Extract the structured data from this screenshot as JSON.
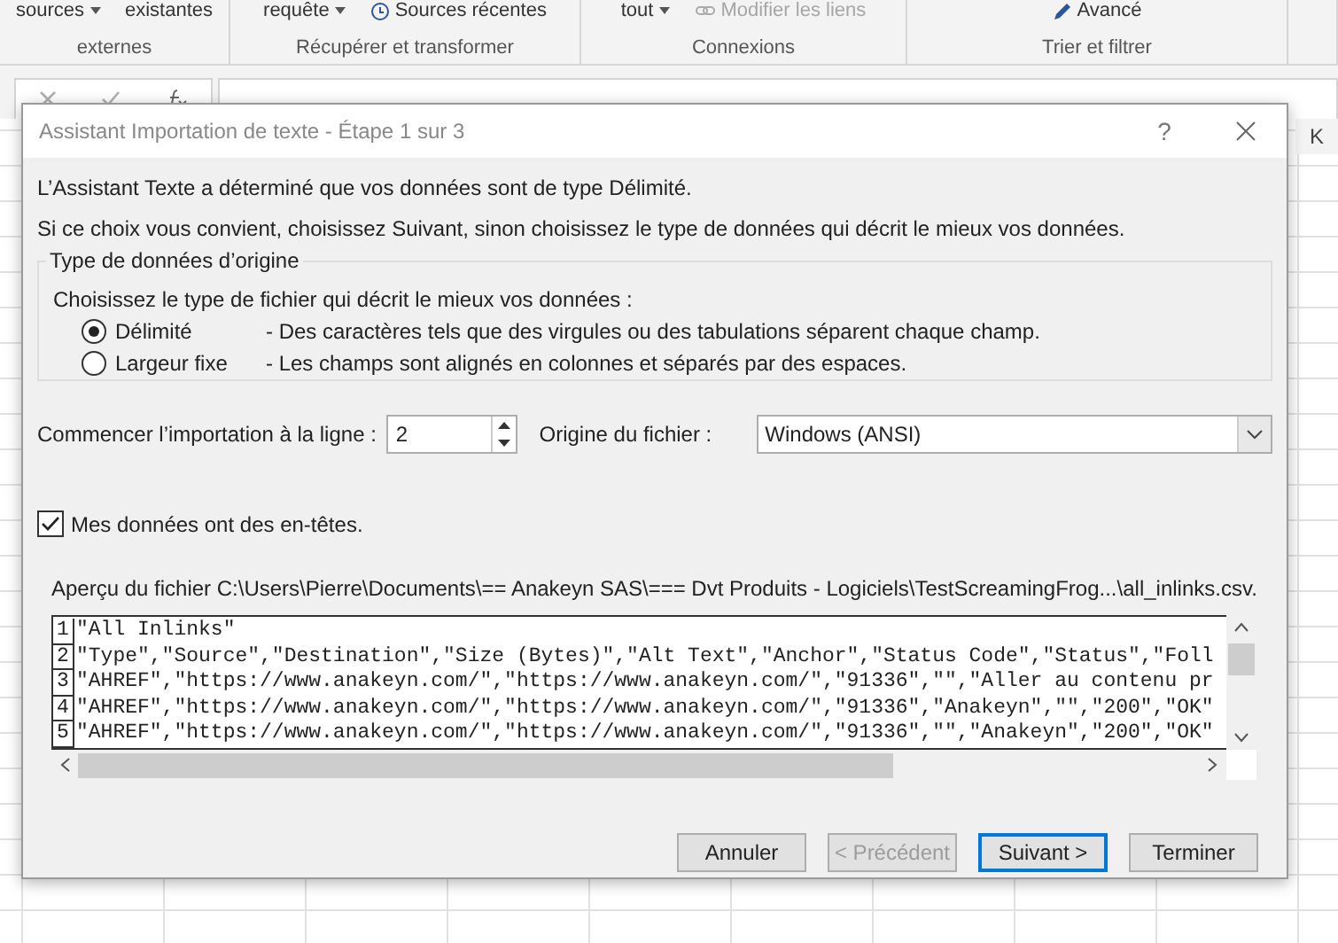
{
  "ribbon": {
    "groups": [
      {
        "label": "externes",
        "items": [
          {
            "label": "sources",
            "dropdown": true,
            "disabled": false
          },
          {
            "label": "existantes",
            "dropdown": false,
            "disabled": false
          }
        ]
      },
      {
        "label": "Récupérer et transformer",
        "items": [
          {
            "label": "requête",
            "dropdown": true,
            "disabled": false
          },
          {
            "label": "Sources récentes",
            "dropdown": false,
            "disabled": false
          }
        ]
      },
      {
        "label": "Connexions",
        "items": [
          {
            "label": "tout",
            "dropdown": true,
            "disabled": false
          },
          {
            "label": "Modifier les liens",
            "dropdown": false,
            "disabled": true
          }
        ]
      },
      {
        "label": "Trier et filtrer",
        "items": [
          {
            "label": "Avancé",
            "dropdown": false,
            "disabled": false
          }
        ]
      }
    ]
  },
  "sheet": {
    "visible_column": "K"
  },
  "dialog": {
    "title": "Assistant Importation de texte - Étape 1 sur 3",
    "help": "?",
    "intro": [
      "L’Assistant Texte a déterminé que vos données sont de type Délimité.",
      "Si ce choix vous convient, choisissez Suivant, sinon choisissez le type de données qui décrit le mieux vos données."
    ],
    "group": {
      "title": "Type de données d’origine",
      "prompt": "Choisissez le type de fichier qui décrit le mieux vos données :",
      "options": [
        {
          "label": "Délimité",
          "description": "- Des caractères tels que des virgules ou des tabulations séparent chaque champ.",
          "selected": true
        },
        {
          "label": "Largeur fixe",
          "description": "- Les champs sont alignés en colonnes et séparés par des espaces.",
          "selected": false
        }
      ]
    },
    "start_row": {
      "label": "Commencer l’importation à la ligne :",
      "value": "2"
    },
    "origin": {
      "label": "Origine du fichier :",
      "value": "Windows (ANSI)"
    },
    "headers": {
      "label": "Mes données ont des en-têtes.",
      "checked": true
    },
    "preview": {
      "label": "Aperçu du fichier C:\\Users\\Pierre\\Documents\\== Anakeyn SAS\\=== Dvt Produits - Logiciels\\TestScreamingFrog...\\all_inlinks.csv.",
      "lines": [
        {
          "number": "1",
          "text": "\"All Inlinks\""
        },
        {
          "number": "2",
          "text": "\"Type\",\"Source\",\"Destination\",\"Size (Bytes)\",\"Alt Text\",\"Anchor\",\"Status Code\",\"Status\",\"Foll"
        },
        {
          "number": "3",
          "text": "\"AHREF\",\"https://www.anakeyn.com/\",\"https://www.anakeyn.com/\",\"91336\",\"\",\"Aller au contenu pr"
        },
        {
          "number": "4",
          "text": "\"AHREF\",\"https://www.anakeyn.com/\",\"https://www.anakeyn.com/\",\"91336\",\"Anakeyn\",\"\",\"200\",\"OK\""
        },
        {
          "number": "5",
          "text": "\"AHREF\",\"https://www.anakeyn.com/\",\"https://www.anakeyn.com/\",\"91336\",\"\",\"Anakeyn\",\"200\",\"OK\""
        }
      ]
    },
    "buttons": [
      {
        "label": "Annuler",
        "disabled": false,
        "default": false
      },
      {
        "label": "< Précédent",
        "disabled": true,
        "default": false
      },
      {
        "label": "Suivant >",
        "disabled": false,
        "default": true
      },
      {
        "label": "Terminer",
        "disabled": false,
        "default": false
      }
    ]
  }
}
